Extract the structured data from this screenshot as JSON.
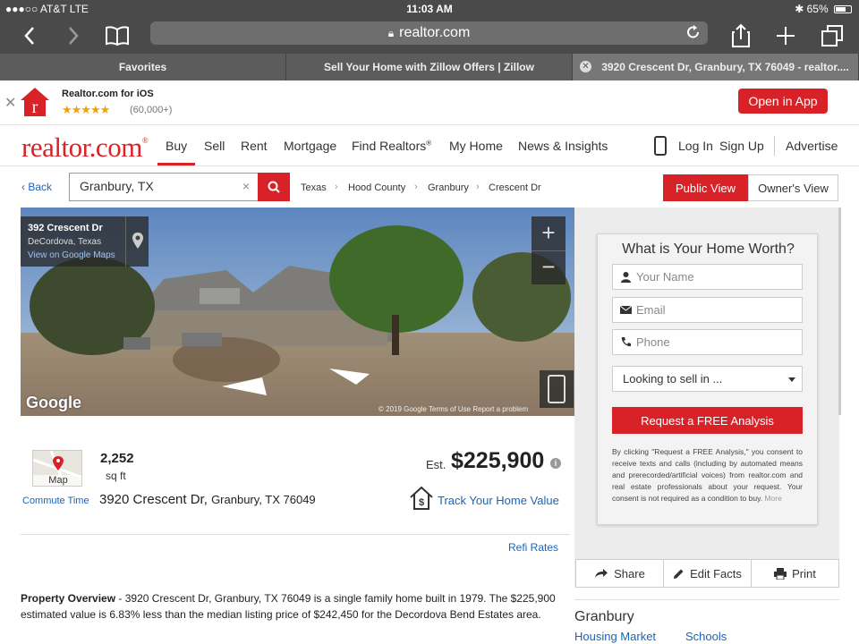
{
  "statusbar": {
    "carrier": "●●●○○ AT&T  LTE",
    "time": "11:03 AM",
    "battery": "65%"
  },
  "browser": {
    "url": "realtor.com",
    "lock_icon": "lock-icon"
  },
  "tabs": [
    {
      "label": "Favorites"
    },
    {
      "label": "Sell Your Home with Zillow Offers | Zillow"
    },
    {
      "label": "3920 Crescent Dr, Granbury, TX 76049 - realtor...."
    }
  ],
  "banner": {
    "app_name": "Realtor.com for iOS",
    "stars": "★★★★★",
    "reviews": "(60,000+)",
    "open_label": "Open in App"
  },
  "nav": {
    "brand": "realtor.com",
    "items": [
      "Buy",
      "Sell",
      "Rent",
      "Mortgage",
      "Find Realtors",
      "My Home",
      "News & Insights"
    ],
    "reg_mark": "®",
    "login": "Log In",
    "signup": "Sign Up",
    "advertise": "Advertise"
  },
  "search": {
    "back": "Back",
    "value": "Granbury, TX",
    "clear": "×",
    "breadcrumbs": [
      "Texas",
      "Hood County",
      "Granbury",
      "Crescent Dr"
    ],
    "public_view": "Public View",
    "owners_view": "Owner's View"
  },
  "streetview": {
    "title": "392 Crescent Dr",
    "subtitle": "DeCordova, Texas",
    "link": "View on Google Maps",
    "plus": "+",
    "minus": "−",
    "google": "Google",
    "footer": "© 2019 Google   Terms of Use   Report a problem"
  },
  "property": {
    "map_label": "Map",
    "commute": "Commute Time",
    "sqft": "2,252",
    "sqft_unit": "sq ft",
    "address_street": "3920 Crescent Dr, ",
    "address_city": "Granbury, TX 76049",
    "est_label": "Est.",
    "price": "$225,900",
    "track": "Track Your Home Value",
    "refi": "Refi Rates",
    "overview_label": "Property Overview",
    "overview_text": " - 3920 Crescent Dr, Granbury, TX 76049 is a single family home built in 1979. The $225,900 estimated value is 6.83% less than the median listing price of $242,450 for the Decordova Bend Estates area."
  },
  "form": {
    "title": "What is Your Home Worth?",
    "name_placeholder": "Your Name",
    "email_placeholder": "Email",
    "phone_placeholder": "Phone",
    "sell_select": "Looking to sell in ...",
    "submit": "Request a FREE Analysis",
    "legal": "By clicking \"Request a FREE Analysis,\" you consent to receive texts and calls (including by automated means and prerecorded/artificial voices) from realtor.com and real estate professionals about your request. Your consent is not required as a condition to buy.",
    "more": "More"
  },
  "actions": {
    "share": "Share",
    "edit": "Edit Facts",
    "print": "Print"
  },
  "city": {
    "name": "Granbury",
    "links": [
      "Housing Market",
      "Schools"
    ]
  },
  "colors": {
    "brand_red": "#d92228",
    "link_blue": "#1a64b8",
    "chrome": "#4a4a4a"
  }
}
